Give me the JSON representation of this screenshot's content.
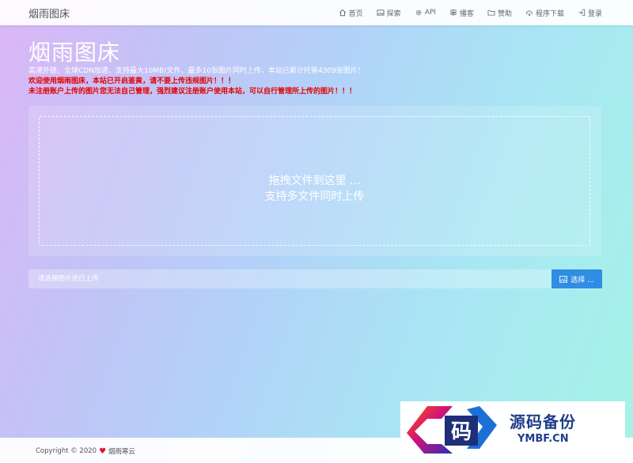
{
  "navbar": {
    "brand": "烟雨图床",
    "items": [
      {
        "label": "首页",
        "icon": "home-icon"
      },
      {
        "label": "探索",
        "icon": "image-icon"
      },
      {
        "label": "API",
        "icon": "gear-icon"
      },
      {
        "label": "播客",
        "icon": "signpost-icon"
      },
      {
        "label": "赞助",
        "icon": "folder-icon"
      },
      {
        "label": "程序下载",
        "icon": "cloud-download-icon"
      },
      {
        "label": "登录",
        "icon": "login-icon"
      }
    ]
  },
  "hero": {
    "title": "烟雨图床",
    "subtitle": "高速外链、全球CDN加速、支持最大10MB/文件、最多10张图片同时上传，本站已累计托管4309张图片！",
    "warning_1": "欢迎使用烟雨图床，本站已开启鉴黄，请不要上传违规图片！！！",
    "warning_2": "未注册账户上传的图片您无法自己管理，强烈建议注册账户使用本站，可以自行管理所上传的图片！！！"
  },
  "dropzone": {
    "line_1": "拖拽文件到这里 ...",
    "line_2": "支持多文件同时上传"
  },
  "upload": {
    "placeholder": "请选择图片进行上传",
    "choose_label": "选择 ..."
  },
  "footer": {
    "copyright": "Copyright © 2020",
    "owner": "烟雨寒云"
  },
  "watermark": {
    "logo_char": "码",
    "name": "源码备份",
    "site": "YMBF.CN"
  },
  "colors": {
    "accent": "#2f8de4",
    "warning": "#e30000",
    "heart": "#e0112b"
  }
}
